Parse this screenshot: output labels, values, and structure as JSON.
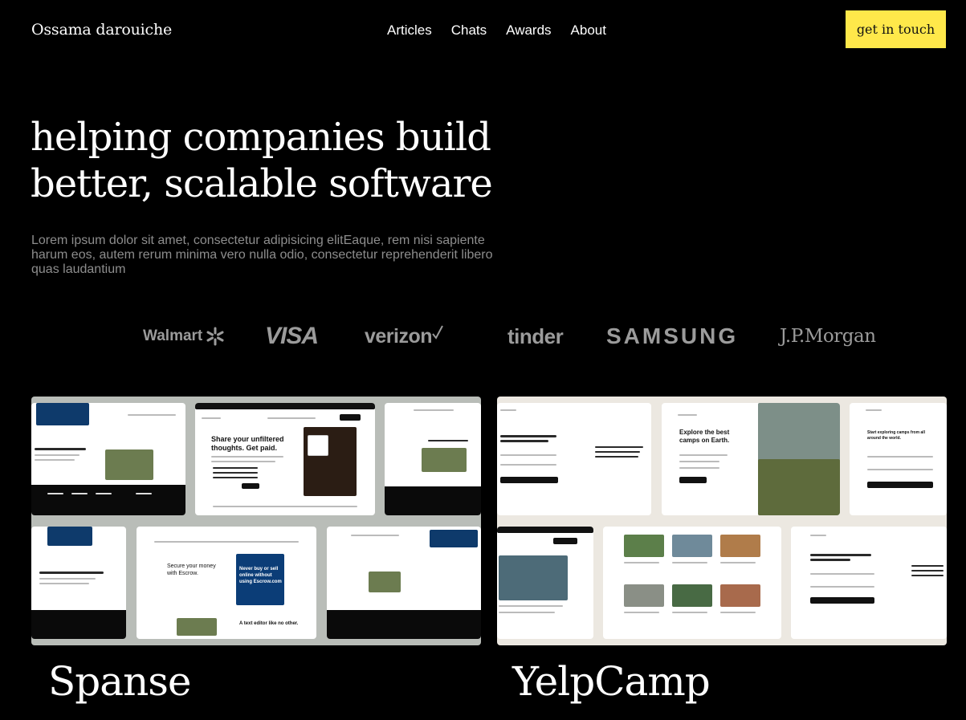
{
  "header": {
    "brand": "Ossama darouiche",
    "nav": [
      "Articles",
      "Chats",
      "Awards",
      "About"
    ],
    "cta_label": "get in touch",
    "cta_color": "#ffe84a"
  },
  "hero": {
    "title_line1": "helping companies build",
    "title_line2": "better, scalable software",
    "subtitle": "Lorem ipsum dolor sit amet, consectetur adipisicing elitEaque, rem nisi sapiente harum eos, autem rerum minima vero nulla odio, consectetur reprehenderit libero quas laudantium"
  },
  "clients": {
    "walmart": "Walmart",
    "visa": "VISA",
    "verizon": "verizon",
    "tinder": "tinder",
    "samsung": "SAMSUNG",
    "jpmorgan": "J.P.Morgan"
  },
  "projects": [
    {
      "title": "Spanse",
      "mockup": {
        "hero_line1": "Share your unfiltered",
        "hero_line2": "thoughts. Get paid.",
        "phone_line1": "Never buy or sell",
        "phone_line2": "online without",
        "phone_line3": "using Escrow.com",
        "secure_line1": "Secure your money",
        "secure_line2": "with Escrow.",
        "editor_heading": "A text editor like no other."
      }
    },
    {
      "title": "YelpCamp",
      "mockup": {
        "heading_line1": "Explore the best",
        "heading_line2": "camps on Earth.",
        "signup_line1": "Start exploring camps from all",
        "signup_line2": "around the world."
      }
    }
  ]
}
